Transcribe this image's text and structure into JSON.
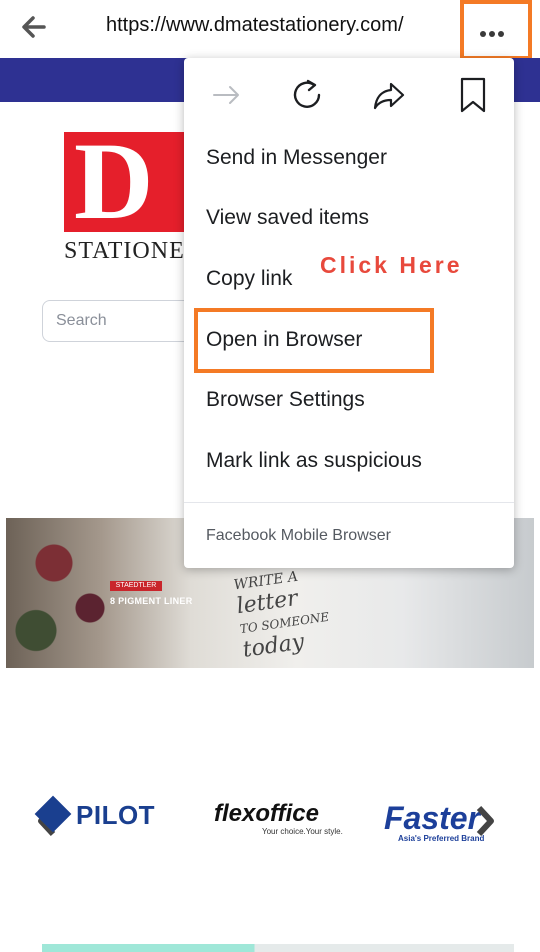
{
  "browser": {
    "url": "https://www.dmatestationery.com/",
    "back_icon": "arrow-left-icon",
    "more_icon": "more-dots-icon"
  },
  "site": {
    "logo_letter": "D",
    "logo_word": "STATIONE",
    "search_placeholder": "Search",
    "banner": {
      "brand_tag": "STAEDTLER",
      "product_text": "8 PIGMENT LINER",
      "art_lines": [
        "WRITE A",
        "letter",
        "TO SOMEONE",
        "today"
      ]
    },
    "brands": [
      {
        "name": "PILOT"
      },
      {
        "name": "flexoffice",
        "tagline": "Your choice.Your style."
      },
      {
        "name": "Faster",
        "tagline": "Asia's Preferred Brand"
      }
    ]
  },
  "menu": {
    "icons": [
      "forward-arrow-icon",
      "refresh-icon",
      "share-icon",
      "bookmark-icon"
    ],
    "items": [
      "Send in Messenger",
      "View saved items",
      "Copy link",
      "Open in Browser",
      "Browser Settings",
      "Mark link as suspicious"
    ],
    "footer": "Facebook Mobile Browser"
  },
  "annotation": {
    "text": "Click Here",
    "color": "#f47a25"
  },
  "colors": {
    "nav_strip": "#2e3192",
    "logo_red": "#e51f2b",
    "logo_green": "#2a9b3c",
    "annotation_text": "#e8493c"
  }
}
